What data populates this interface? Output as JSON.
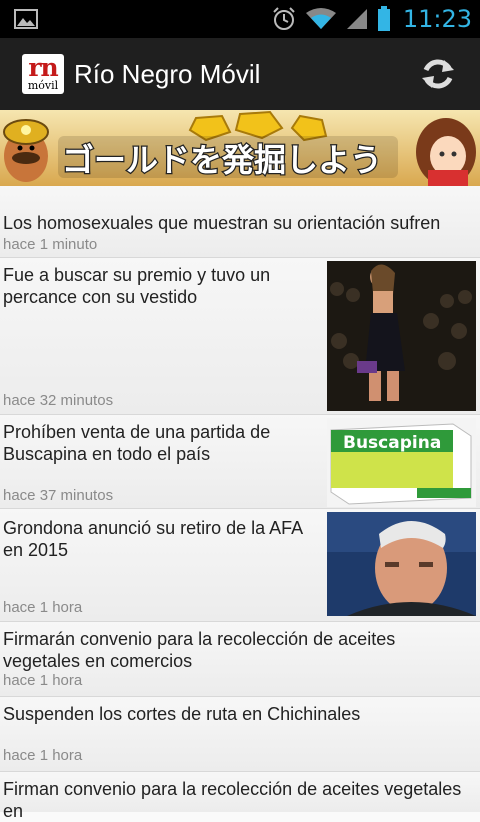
{
  "status_bar": {
    "time": "11:23",
    "icons": [
      "picture-icon",
      "alarm-icon",
      "wifi-icon",
      "signal-icon",
      "battery-icon"
    ]
  },
  "app_bar": {
    "logo_top": "rn",
    "logo_bottom": "móvil",
    "title": "Río Negro Móvil",
    "refresh_icon": "refresh-icon"
  },
  "banner": {
    "text": "ゴールドを発掘しよう"
  },
  "news": [
    {
      "title": "Los homosexuales que muestran su orientación sufren",
      "time": "hace 1 minuto",
      "has_image": false
    },
    {
      "title": "Fue a buscar su premio y tuvo un percance con su vestido",
      "time": "hace 32 minutos",
      "has_image": true
    },
    {
      "title": "Prohíben venta de una partida de Buscapina en todo el país",
      "time": "hace 37 minutos",
      "has_image": true,
      "image_text": "Buscapina"
    },
    {
      "title": "Grondona anunció su retiro de la AFA en 2015",
      "time": "hace 1 hora",
      "has_image": true
    },
    {
      "title": "Firmarán convenio para la recolección de aceites vegetales en comercios",
      "time": "hace 1 hora",
      "has_image": false
    },
    {
      "title": "Suspenden los cortes de ruta en Chichinales",
      "time": "hace 1 hora",
      "has_image": false
    },
    {
      "title": "Firman convenio para la recolección de aceites vegetales en",
      "time": "",
      "has_image": false
    }
  ],
  "colors": {
    "clock": "#33b5e5",
    "app_bar": "#1f1f1f",
    "logo_red": "#c41a1a"
  }
}
